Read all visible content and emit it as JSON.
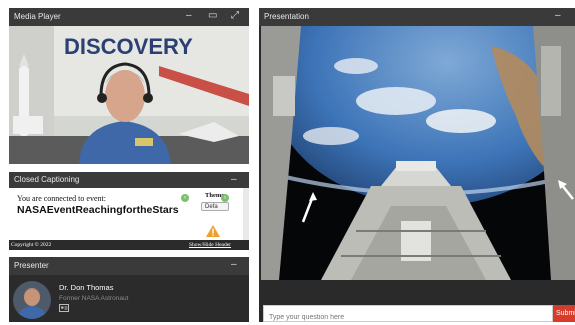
{
  "media_player": {
    "title": "Media Player",
    "controls": {
      "minimize": "–",
      "restore": "▭",
      "expand": "⤢"
    },
    "banner_text": "DISCOVERY"
  },
  "closed_captioning": {
    "title": "Closed Captioning",
    "minimize": "–",
    "connected_text": "You are connected to event:",
    "event_name": "NASAEventReachingfortheStars",
    "theme_label": "Theme",
    "theme_value": "Defa",
    "copyright": "Copyright © 2022",
    "show_hide": "Show/Hide Header"
  },
  "presenter": {
    "title": "Presenter",
    "minimize": "–",
    "name": "Dr. Don Thomas",
    "role": "Former NASA Astronaut"
  },
  "presentation": {
    "title": "Presentation",
    "minimize": "–"
  },
  "question": {
    "placeholder": "Type your question here",
    "submit_label": "Submit"
  },
  "colors": {
    "panel_bg": "#2b2b2b",
    "header_bg": "#3a3a3a",
    "submit_red": "#d63b2c",
    "flight_suit_blue": "#3f68a8"
  }
}
